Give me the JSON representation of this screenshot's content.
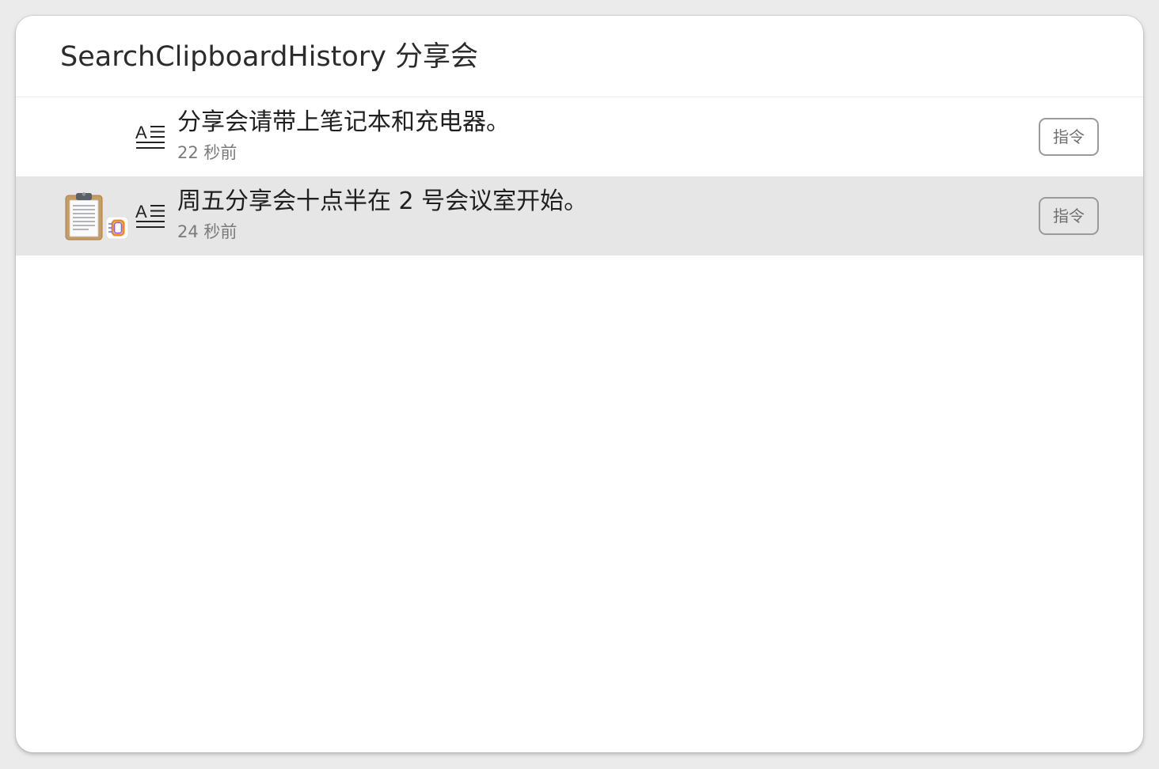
{
  "search": {
    "query": "SearchClipboardHistory 分享会"
  },
  "results": [
    {
      "title": "分享会请带上笔记本和充电器。",
      "subtitle": "22 秒前",
      "action_label": "指令",
      "icon": "text-icon",
      "selected": false
    },
    {
      "title": "周五分享会十点半在 2 号会议室开始。",
      "subtitle": "24 秒前",
      "action_label": "指令",
      "icon": "text-icon",
      "app_icon": "clipboard-icon",
      "badge_icon": "app-badge-icon",
      "selected": true
    }
  ],
  "colors": {
    "selected_row": "#e6e6e6",
    "title_text": "#1f1f1f",
    "subtitle_text": "#7a7a7a",
    "button_border": "#9a9a9a"
  }
}
